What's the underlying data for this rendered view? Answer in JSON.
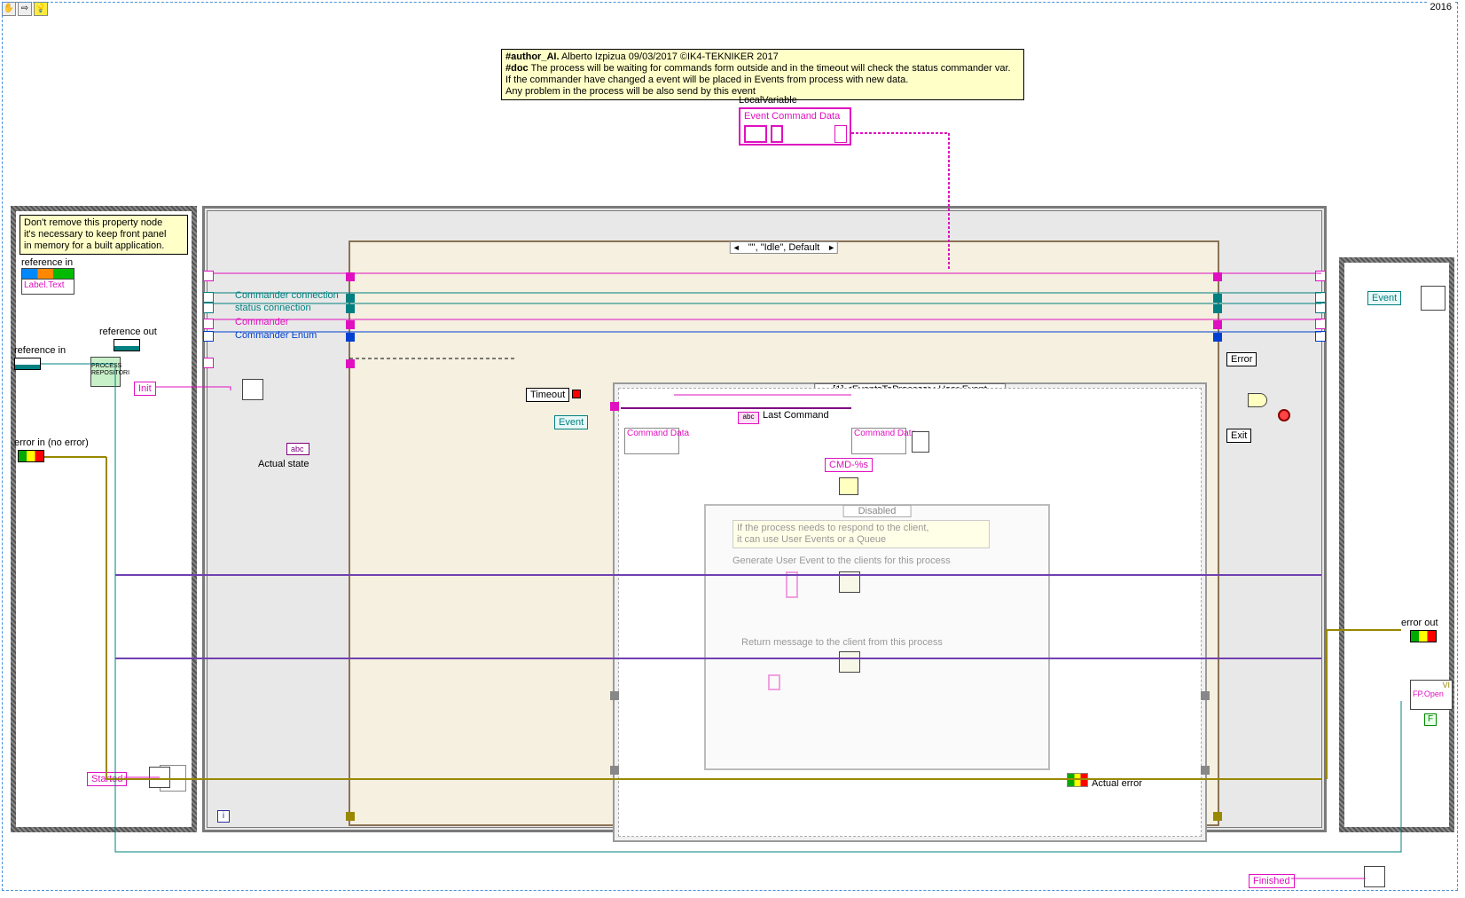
{
  "toolbar": {
    "btn1": "✋",
    "btn2": "⇨",
    "btn3": "💡"
  },
  "year": "2016",
  "doc": {
    "author_key": "#author_AI.",
    "author": " Alberto Izpizua 09/03/2017 ©IK4-TEKNIKER 2017",
    "doc_key": "#doc",
    "l1": " The process will be waiting for commands form outside and in the timeout will check the status commander var.",
    "l2": "If the commander have changed a event will be placed in Events from process with new data.",
    "l3": "Any problem in the process will be also send by this event"
  },
  "local_var_title": "LocalVariable",
  "local_var_name": "Event Command Data",
  "note1": {
    "l1": "Don't remove this property node",
    "l2": "it's necessary to keep front panel",
    "l3": "in memory for a built application."
  },
  "left": {
    "ref_in": "reference in",
    "ref_out": "reference out",
    "err_in": "error in (no error)",
    "label_text": "Label.Text",
    "proc_rep": "PROCESS\nREPOSITORI",
    "started": "Started",
    "init": "Init"
  },
  "loop_labels": {
    "cmdr_conn": "Commander connection",
    "stat_conn": "status connection",
    "commander": "Commander",
    "cmdr_enum": "Commander Enum",
    "actual_state": "Actual state"
  },
  "case_selector": "\"\", \"Idle\", Default",
  "timeout": "Timeout",
  "event_selector": "[1] <EventsToProcess>: User Event",
  "event_const": "Event",
  "last_cmd": "Last Command",
  "cmd_data": "Command Data",
  "cmd_data2": "Command Data",
  "cmd_fmt": "CMD-%s",
  "disabled": "Disabled",
  "dis_note": {
    "l1": "If the process needs to respond to the client,",
    "l2": "it can use User Events or a Queue"
  },
  "gen_evt": "Generate User Event to the clients for this process",
  "ret_msg": "Return message to the client from this process",
  "right": {
    "error": "Error",
    "event": "Event",
    "exit": "Exit",
    "actual_error": "Actual error",
    "finished": "Finished",
    "err_out": "error out",
    "vi": "VI",
    "fp_open": "FP.Open",
    "false": "F"
  }
}
